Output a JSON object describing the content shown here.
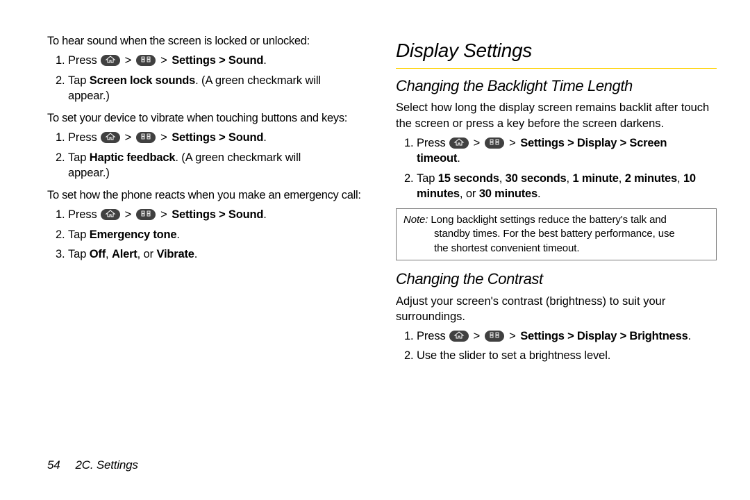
{
  "left": {
    "intro1": "To hear sound when the screen is locked or unlocked:",
    "steps1": {
      "s1_pre": "Press ",
      "s1_path": "Settings > Sound",
      "s1_post": ".",
      "s2_a": "Tap ",
      "s2_b": "Screen lock sounds",
      "s2_c": ". (A green checkmark will",
      "s2_d": "appear.)"
    },
    "intro2": "To set your device to vibrate when touching buttons and keys:",
    "steps2": {
      "s1_pre": "Press ",
      "s1_path": "Settings > Sound",
      "s1_post": ".",
      "s2_a": "Tap ",
      "s2_b": "Haptic feedback",
      "s2_c": ". (A green checkmark will",
      "s2_d": "appear.)"
    },
    "intro3": "To set  how the phone reacts when you make an emergency call:",
    "steps3": {
      "s1_pre": "Press ",
      "s1_path": "Settings > Sound",
      "s1_post": ".",
      "s2_a": "Tap ",
      "s2_b": "Emergency tone",
      "s2_c": ".",
      "s3_a": "Tap ",
      "s3_b": "Off",
      "s3_c": ", ",
      "s3_d": "Alert",
      "s3_e": ", or ",
      "s3_f": "Vibrate",
      "s3_g": "."
    }
  },
  "right": {
    "title": "Display Settings",
    "sub1": "Changing the Backlight Time Length",
    "p1": "Select how long the display screen remains backlit after touch the screen or press a key before the screen darkens.",
    "steps1": {
      "s1_pre": "Press ",
      "s1_path": "Settings > Display > Screen",
      "s1_path2": "timeout",
      "s1_post": ".",
      "s2_a": "Tap ",
      "s2_b": "15 seconds",
      "s2_c": ", ",
      "s2_d": "30 seconds",
      "s2_e": ", ",
      "s2_f": "1 minute",
      "s2_g": ", ",
      "s2_h": "2 minutes",
      "s2_i": ", ",
      "s2_j": "10",
      "s2_k": "minutes",
      "s2_l": ", or ",
      "s2_m": "30 minutes",
      "s2_n": "."
    },
    "note_label": "Note:",
    "note_body1": "Long backlight settings reduce the battery's talk and",
    "note_body2": "standby times. For the best battery performance, use",
    "note_body3": "the shortest convenient timeout.",
    "sub2": "Changing the Contrast",
    "p2": "Adjust your screen's contrast (brightness) to suit your surroundings.",
    "steps2": {
      "s1_pre": "Press ",
      "s1_path": "Settings > Display > Brightness",
      "s1_post": ".",
      "s2": "Use the slider to set a brightness level."
    }
  },
  "footer": {
    "page": "54",
    "section": "2C. Settings"
  },
  "gt": ">"
}
